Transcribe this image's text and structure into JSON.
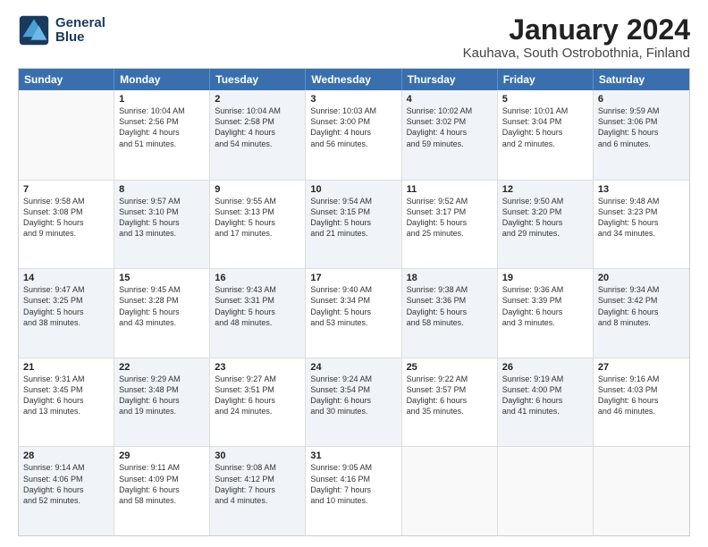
{
  "header": {
    "logo_line1": "General",
    "logo_line2": "Blue",
    "title": "January 2024",
    "subtitle": "Kauhava, South Ostrobothnia, Finland"
  },
  "calendar": {
    "days_of_week": [
      "Sunday",
      "Monday",
      "Tuesday",
      "Wednesday",
      "Thursday",
      "Friday",
      "Saturday"
    ],
    "rows": [
      [
        {
          "day": "",
          "info": "",
          "shaded": false,
          "empty": true
        },
        {
          "day": "1",
          "info": "Sunrise: 10:04 AM\nSunset: 2:56 PM\nDaylight: 4 hours\nand 51 minutes.",
          "shaded": false,
          "empty": false
        },
        {
          "day": "2",
          "info": "Sunrise: 10:04 AM\nSunset: 2:58 PM\nDaylight: 4 hours\nand 54 minutes.",
          "shaded": true,
          "empty": false
        },
        {
          "day": "3",
          "info": "Sunrise: 10:03 AM\nSunset: 3:00 PM\nDaylight: 4 hours\nand 56 minutes.",
          "shaded": false,
          "empty": false
        },
        {
          "day": "4",
          "info": "Sunrise: 10:02 AM\nSunset: 3:02 PM\nDaylight: 4 hours\nand 59 minutes.",
          "shaded": true,
          "empty": false
        },
        {
          "day": "5",
          "info": "Sunrise: 10:01 AM\nSunset: 3:04 PM\nDaylight: 5 hours\nand 2 minutes.",
          "shaded": false,
          "empty": false
        },
        {
          "day": "6",
          "info": "Sunrise: 9:59 AM\nSunset: 3:06 PM\nDaylight: 5 hours\nand 6 minutes.",
          "shaded": true,
          "empty": false
        }
      ],
      [
        {
          "day": "7",
          "info": "Sunrise: 9:58 AM\nSunset: 3:08 PM\nDaylight: 5 hours\nand 9 minutes.",
          "shaded": false,
          "empty": false
        },
        {
          "day": "8",
          "info": "Sunrise: 9:57 AM\nSunset: 3:10 PM\nDaylight: 5 hours\nand 13 minutes.",
          "shaded": true,
          "empty": false
        },
        {
          "day": "9",
          "info": "Sunrise: 9:55 AM\nSunset: 3:13 PM\nDaylight: 5 hours\nand 17 minutes.",
          "shaded": false,
          "empty": false
        },
        {
          "day": "10",
          "info": "Sunrise: 9:54 AM\nSunset: 3:15 PM\nDaylight: 5 hours\nand 21 minutes.",
          "shaded": true,
          "empty": false
        },
        {
          "day": "11",
          "info": "Sunrise: 9:52 AM\nSunset: 3:17 PM\nDaylight: 5 hours\nand 25 minutes.",
          "shaded": false,
          "empty": false
        },
        {
          "day": "12",
          "info": "Sunrise: 9:50 AM\nSunset: 3:20 PM\nDaylight: 5 hours\nand 29 minutes.",
          "shaded": true,
          "empty": false
        },
        {
          "day": "13",
          "info": "Sunrise: 9:48 AM\nSunset: 3:23 PM\nDaylight: 5 hours\nand 34 minutes.",
          "shaded": false,
          "empty": false
        }
      ],
      [
        {
          "day": "14",
          "info": "Sunrise: 9:47 AM\nSunset: 3:25 PM\nDaylight: 5 hours\nand 38 minutes.",
          "shaded": true,
          "empty": false
        },
        {
          "day": "15",
          "info": "Sunrise: 9:45 AM\nSunset: 3:28 PM\nDaylight: 5 hours\nand 43 minutes.",
          "shaded": false,
          "empty": false
        },
        {
          "day": "16",
          "info": "Sunrise: 9:43 AM\nSunset: 3:31 PM\nDaylight: 5 hours\nand 48 minutes.",
          "shaded": true,
          "empty": false
        },
        {
          "day": "17",
          "info": "Sunrise: 9:40 AM\nSunset: 3:34 PM\nDaylight: 5 hours\nand 53 minutes.",
          "shaded": false,
          "empty": false
        },
        {
          "day": "18",
          "info": "Sunrise: 9:38 AM\nSunset: 3:36 PM\nDaylight: 5 hours\nand 58 minutes.",
          "shaded": true,
          "empty": false
        },
        {
          "day": "19",
          "info": "Sunrise: 9:36 AM\nSunset: 3:39 PM\nDaylight: 6 hours\nand 3 minutes.",
          "shaded": false,
          "empty": false
        },
        {
          "day": "20",
          "info": "Sunrise: 9:34 AM\nSunset: 3:42 PM\nDaylight: 6 hours\nand 8 minutes.",
          "shaded": true,
          "empty": false
        }
      ],
      [
        {
          "day": "21",
          "info": "Sunrise: 9:31 AM\nSunset: 3:45 PM\nDaylight: 6 hours\nand 13 minutes.",
          "shaded": false,
          "empty": false
        },
        {
          "day": "22",
          "info": "Sunrise: 9:29 AM\nSunset: 3:48 PM\nDaylight: 6 hours\nand 19 minutes.",
          "shaded": true,
          "empty": false
        },
        {
          "day": "23",
          "info": "Sunrise: 9:27 AM\nSunset: 3:51 PM\nDaylight: 6 hours\nand 24 minutes.",
          "shaded": false,
          "empty": false
        },
        {
          "day": "24",
          "info": "Sunrise: 9:24 AM\nSunset: 3:54 PM\nDaylight: 6 hours\nand 30 minutes.",
          "shaded": true,
          "empty": false
        },
        {
          "day": "25",
          "info": "Sunrise: 9:22 AM\nSunset: 3:57 PM\nDaylight: 6 hours\nand 35 minutes.",
          "shaded": false,
          "empty": false
        },
        {
          "day": "26",
          "info": "Sunrise: 9:19 AM\nSunset: 4:00 PM\nDaylight: 6 hours\nand 41 minutes.",
          "shaded": true,
          "empty": false
        },
        {
          "day": "27",
          "info": "Sunrise: 9:16 AM\nSunset: 4:03 PM\nDaylight: 6 hours\nand 46 minutes.",
          "shaded": false,
          "empty": false
        }
      ],
      [
        {
          "day": "28",
          "info": "Sunrise: 9:14 AM\nSunset: 4:06 PM\nDaylight: 6 hours\nand 52 minutes.",
          "shaded": true,
          "empty": false
        },
        {
          "day": "29",
          "info": "Sunrise: 9:11 AM\nSunset: 4:09 PM\nDaylight: 6 hours\nand 58 minutes.",
          "shaded": false,
          "empty": false
        },
        {
          "day": "30",
          "info": "Sunrise: 9:08 AM\nSunset: 4:12 PM\nDaylight: 7 hours\nand 4 minutes.",
          "shaded": true,
          "empty": false
        },
        {
          "day": "31",
          "info": "Sunrise: 9:05 AM\nSunset: 4:16 PM\nDaylight: 7 hours\nand 10 minutes.",
          "shaded": false,
          "empty": false
        },
        {
          "day": "",
          "info": "",
          "shaded": false,
          "empty": true
        },
        {
          "day": "",
          "info": "",
          "shaded": false,
          "empty": true
        },
        {
          "day": "",
          "info": "",
          "shaded": false,
          "empty": true
        }
      ]
    ]
  }
}
